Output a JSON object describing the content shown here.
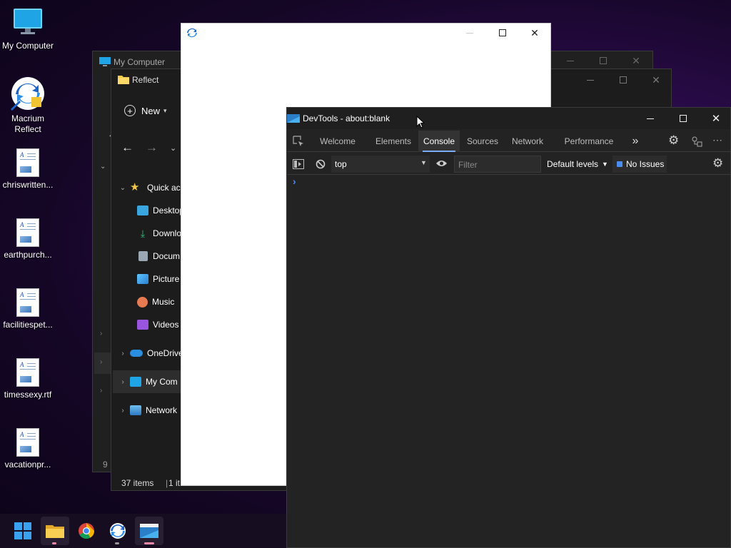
{
  "desktop": {
    "icons": [
      {
        "label": "My Computer",
        "icon": "monitor-icon"
      },
      {
        "label": "Macrium Reflect",
        "icon": "macrium-icon"
      },
      {
        "label": "chriswritten...",
        "icon": "document-icon"
      },
      {
        "label": "earthpurch...",
        "icon": "document-icon"
      },
      {
        "label": "facilitiespet...",
        "icon": "document-icon"
      },
      {
        "label": "timessexy.rtf",
        "icon": "document-icon"
      },
      {
        "label": "vacationpr...",
        "icon": "document-icon"
      }
    ]
  },
  "explorer_back": {
    "title": "My Computer",
    "items_fragment": "9"
  },
  "explorer_front": {
    "title": "Reflect",
    "new_label": "New",
    "nav": [
      {
        "label": "Quick ac",
        "icon": "star-icon",
        "expander": "v"
      },
      {
        "label": "Desktop",
        "icon": "desktop-folder-icon"
      },
      {
        "label": "Downlo",
        "icon": "download-icon"
      },
      {
        "label": "Docum",
        "icon": "documents-icon"
      },
      {
        "label": "Picture",
        "icon": "pictures-icon"
      },
      {
        "label": "Music",
        "icon": "music-icon"
      },
      {
        "label": "Videos",
        "icon": "videos-icon"
      },
      {
        "label": "OneDrive",
        "icon": "onedrive-icon",
        "expander": ">"
      },
      {
        "label": "My Com",
        "icon": "monitor-icon",
        "expander": ">"
      },
      {
        "label": "Network",
        "icon": "network-icon",
        "expander": ">"
      }
    ],
    "status_items": "37 items",
    "status_selected": "1 it"
  },
  "devtools": {
    "title": "DevTools - about:blank",
    "tabs": [
      "Welcome",
      "Elements",
      "Console",
      "Sources",
      "Network",
      "Performance"
    ],
    "active_tab": "Console",
    "more_tabs": "»",
    "context": "top",
    "filter_placeholder": "Filter",
    "levels": "Default levels",
    "issues": "No Issues",
    "prompt": "›"
  },
  "blank_window": {},
  "colors": {
    "accent": "#7cacf8",
    "folder_yellow": "#f3c94b",
    "window_bg": "#202020",
    "devtools_bg": "#232323"
  }
}
